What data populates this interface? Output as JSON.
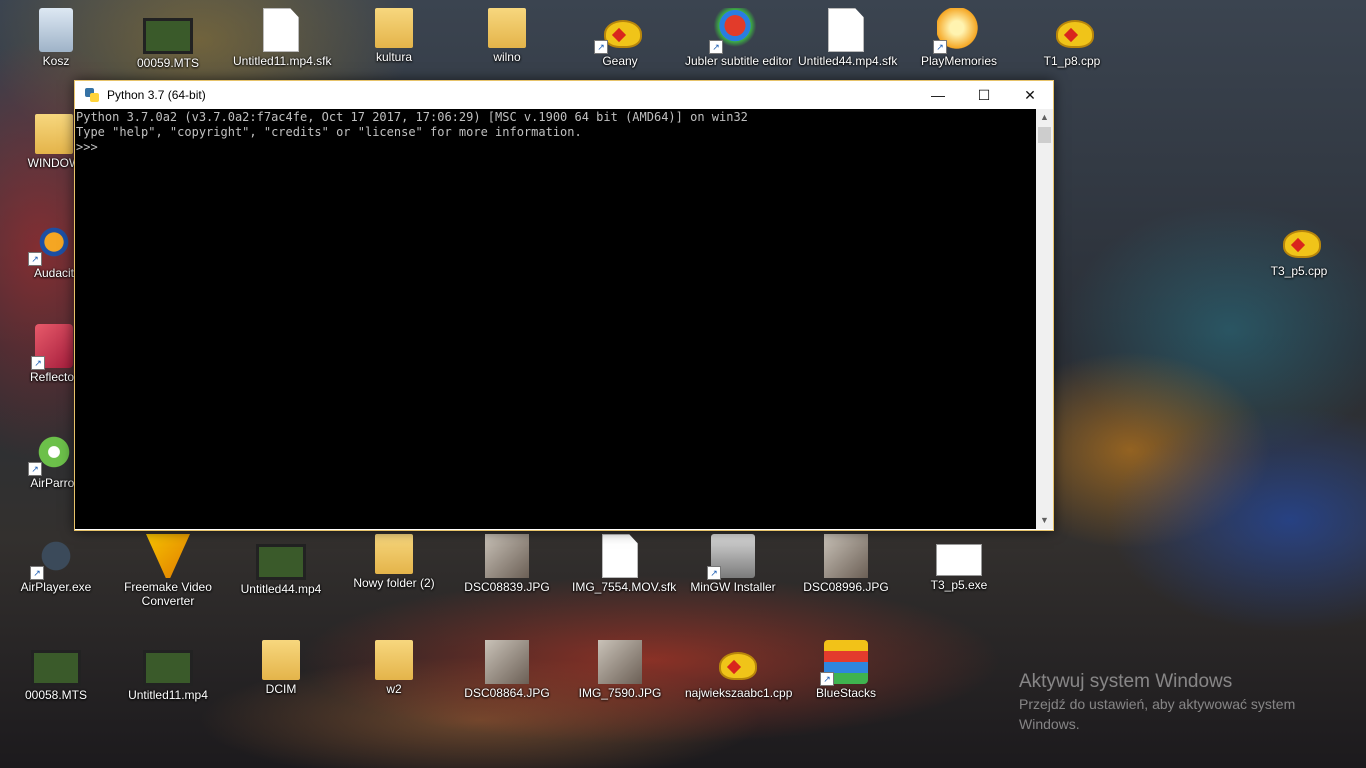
{
  "desktop": {
    "icons": [
      {
        "label": "Kosz"
      },
      {
        "label": "00059.MTS"
      },
      {
        "label": "Untitled11.mp4.sfk"
      },
      {
        "label": "kultura"
      },
      {
        "label": "wilno"
      },
      {
        "label": "Geany"
      },
      {
        "label": "Jubler subtitle editor"
      },
      {
        "label": "Untitled44.mp4.sfk"
      },
      {
        "label": "PlayMemories"
      },
      {
        "label": "T1_p8.cpp"
      },
      {
        "label": "WINDOW"
      },
      {
        "label": "Audacit"
      },
      {
        "label": "Reflector"
      },
      {
        "label": "AirParrot"
      },
      {
        "label": "T3_p5.cpp"
      },
      {
        "label": "AirPlayer.exe"
      },
      {
        "label": "Freemake Video Converter"
      },
      {
        "label": "Untitled44.mp4"
      },
      {
        "label": "Nowy folder (2)"
      },
      {
        "label": "DSC08839.JPG"
      },
      {
        "label": "IMG_7554.MOV.sfk"
      },
      {
        "label": "MinGW Installer"
      },
      {
        "label": "DSC08996.JPG"
      },
      {
        "label": "T3_p5.exe"
      },
      {
        "label": "00058.MTS"
      },
      {
        "label": "Untitled11.mp4"
      },
      {
        "label": "DCIM"
      },
      {
        "label": "w2"
      },
      {
        "label": "DSC08864.JPG"
      },
      {
        "label": "IMG_7590.JPG"
      },
      {
        "label": "najwiekszaabc1.cpp"
      },
      {
        "label": "BlueStacks"
      }
    ]
  },
  "window": {
    "title": "Python 3.7 (64-bit)",
    "minimize": "—",
    "maximize": "☐",
    "close": "✕",
    "console_lines": [
      "Python 3.7.0a2 (v3.7.0a2:f7ac4fe, Oct 17 2017, 17:06:29) [MSC v.1900 64 bit (AMD64)] on win32",
      "Type \"help\", \"copyright\", \"credits\" or \"license\" for more information.",
      ">>> "
    ]
  },
  "activation": {
    "title": "Aktywuj system Windows",
    "subtitle": "Przejdź do ustawień, aby aktywować system Windows."
  },
  "icons_semantic": {
    "window_icon": "python-icon",
    "scroll_up": "chevron-up-icon",
    "scroll_down": "chevron-down-icon"
  }
}
